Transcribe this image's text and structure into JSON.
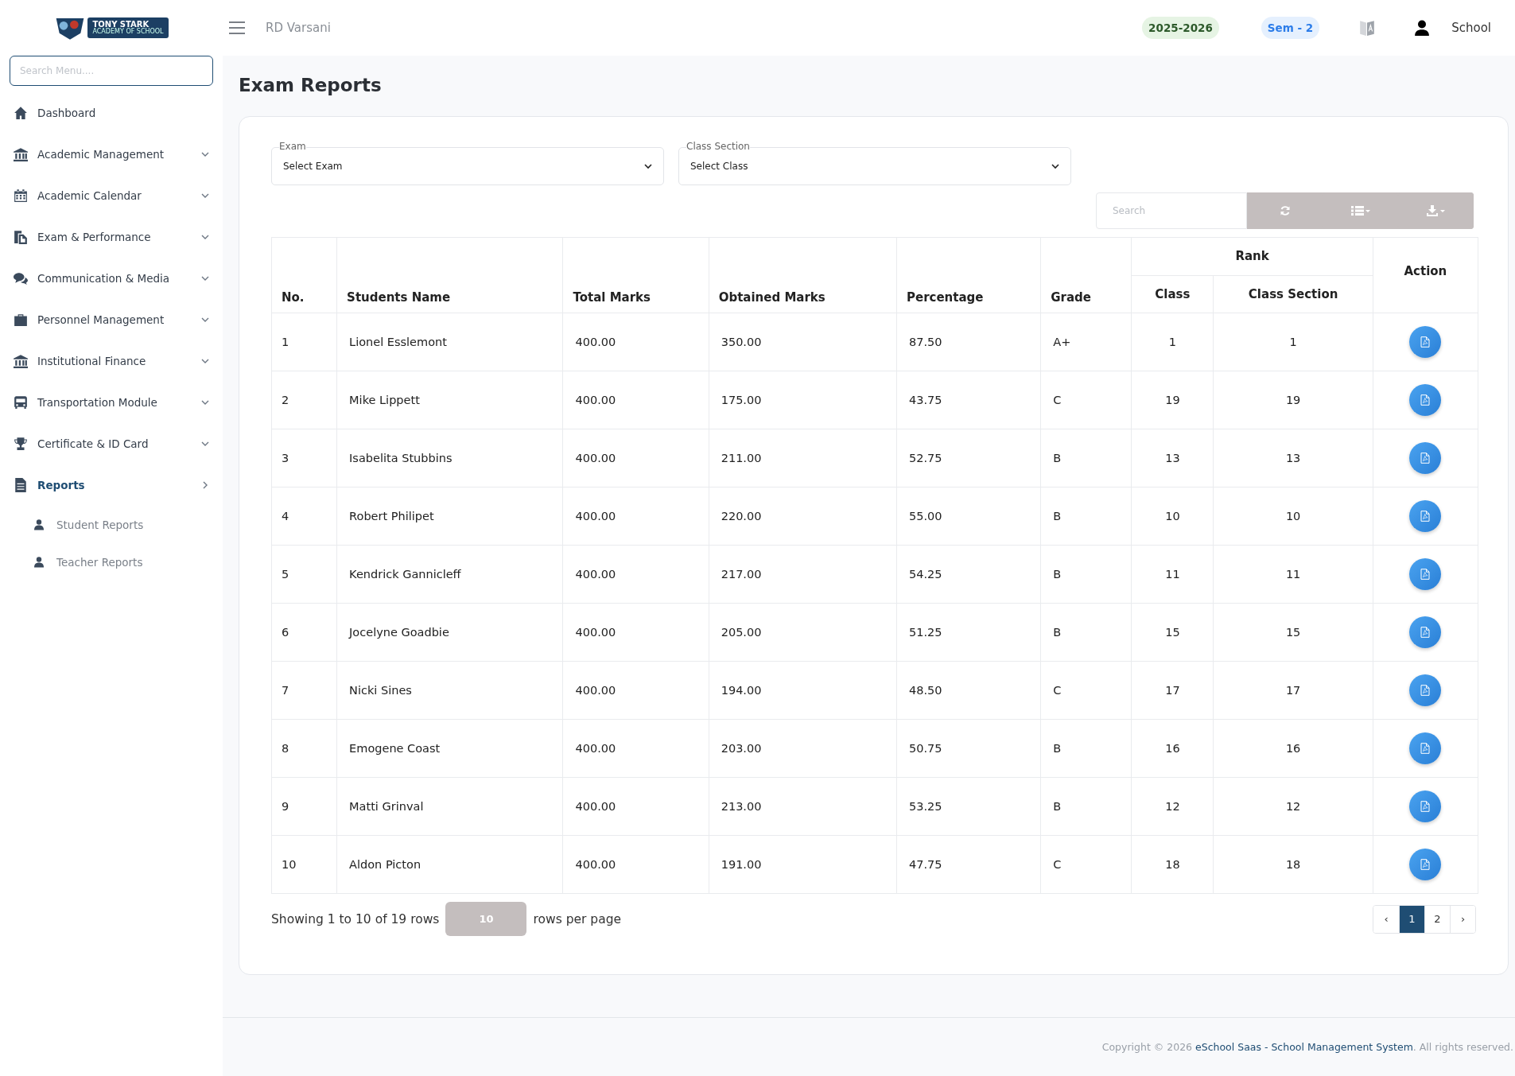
{
  "logo": {
    "title": "TONY STARK",
    "subtitle": "ACADEMY OF SCHOOL"
  },
  "sidebar": {
    "search": {
      "placeholder": "Search Menu...."
    },
    "items": [
      {
        "label": "Dashboard",
        "expandable": false,
        "selected": false
      },
      {
        "label": "Academic Management",
        "expandable": true,
        "selected": false
      },
      {
        "label": "Academic Calendar",
        "expandable": true,
        "selected": false
      },
      {
        "label": "Exam & Performance",
        "expandable": true,
        "selected": false
      },
      {
        "label": "Communication & Media",
        "expandable": true,
        "selected": false
      },
      {
        "label": "Personnel Management",
        "expandable": true,
        "selected": false
      },
      {
        "label": "Institutional Finance",
        "expandable": true,
        "selected": false
      },
      {
        "label": "Transportation Module",
        "expandable": true,
        "selected": false
      },
      {
        "label": "Certificate & ID Card",
        "expandable": true,
        "selected": false
      },
      {
        "label": "Reports",
        "expandable": true,
        "selected": true,
        "children": [
          {
            "label": "Student Reports",
            "selected": false
          },
          {
            "label": "Teacher Reports",
            "selected": false
          }
        ]
      }
    ]
  },
  "topbar": {
    "school": "RD Varsani",
    "session": "2025-2026",
    "semester": "Sem - 2",
    "user": "School"
  },
  "page": {
    "title": "Exam Reports"
  },
  "filters": [
    {
      "label": "Exam",
      "value": "Select Exam"
    },
    {
      "label": "Class Section",
      "value": "Select Class"
    }
  ],
  "table": {
    "search": {
      "placeholder": "Search"
    },
    "columns": [
      "No.",
      "Students Name",
      "Total Marks",
      "Obtained Marks",
      "Percentage",
      "Grade"
    ],
    "rank_group": "Rank",
    "rank_columns": [
      "Class",
      "Class Section"
    ],
    "action_column": "Action",
    "rows": [
      [
        "1",
        "Lionel Esslemont",
        "400.00",
        "350.00",
        "87.50",
        "A+",
        "1",
        "1"
      ],
      [
        "2",
        "Mike Lippett",
        "400.00",
        "175.00",
        "43.75",
        "C",
        "19",
        "19"
      ],
      [
        "3",
        "Isabelita Stubbins",
        "400.00",
        "211.00",
        "52.75",
        "B",
        "13",
        "13"
      ],
      [
        "4",
        "Robert Philipet",
        "400.00",
        "220.00",
        "55.00",
        "B",
        "10",
        "10"
      ],
      [
        "5",
        "Kendrick Gannicleff",
        "400.00",
        "217.00",
        "54.25",
        "B",
        "11",
        "11"
      ],
      [
        "6",
        "Jocelyne Goadbie",
        "400.00",
        "205.00",
        "51.25",
        "B",
        "15",
        "15"
      ],
      [
        "7",
        "Nicki Sines",
        "400.00",
        "194.00",
        "48.50",
        "C",
        "17",
        "17"
      ],
      [
        "8",
        "Emogene Coast",
        "400.00",
        "203.00",
        "50.75",
        "B",
        "16",
        "16"
      ],
      [
        "9",
        "Matti Grinval",
        "400.00",
        "213.00",
        "53.25",
        "B",
        "12",
        "12"
      ],
      [
        "10",
        "Aldon Picton",
        "400.00",
        "191.00",
        "47.75",
        "C",
        "18",
        "18"
      ]
    ]
  },
  "pagination": {
    "summary": "Showing 1 to 10 of 19 rows",
    "page_size": "10",
    "page_size_suffix": "rows per page",
    "prev": "‹",
    "next": "›",
    "pages": [
      {
        "label": "1",
        "selected": true
      },
      {
        "label": "2",
        "selected": false
      }
    ]
  },
  "footer": {
    "prefix": "Copyright © 2026",
    "link": "eSchool Saas - School Management System",
    "suffix": ". All rights reserved."
  }
}
